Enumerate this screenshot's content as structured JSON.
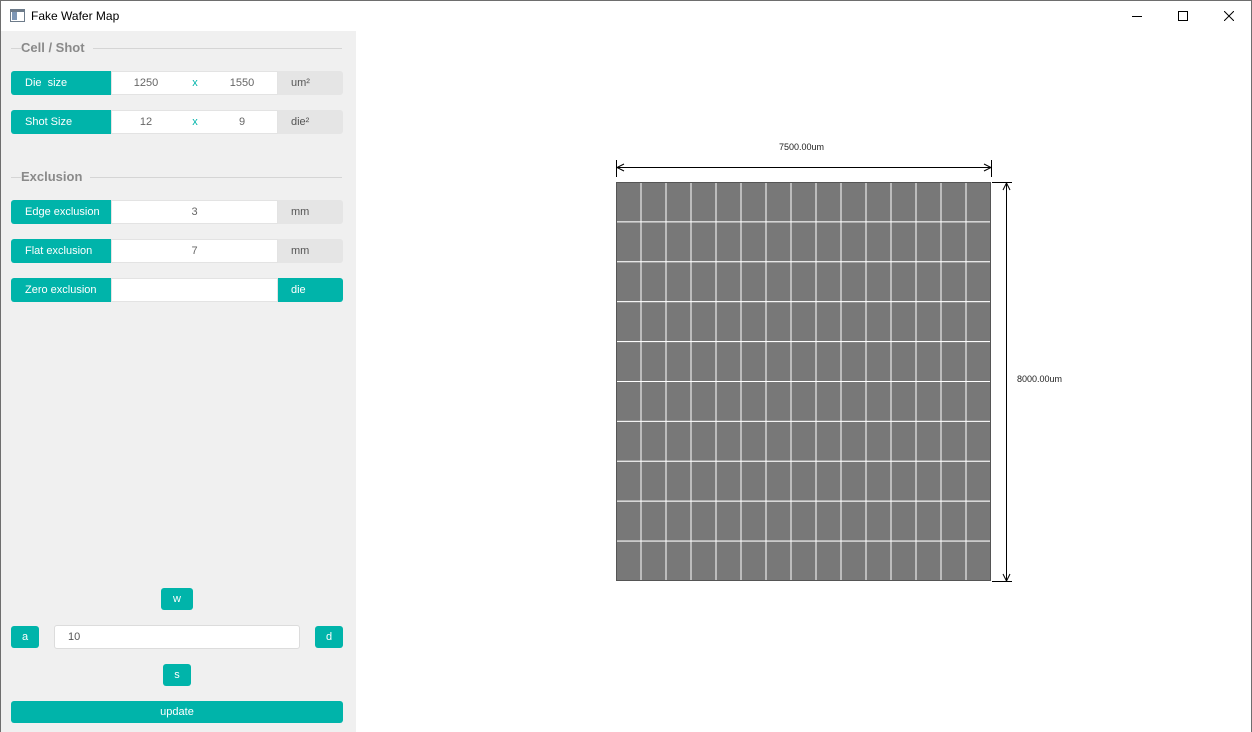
{
  "window": {
    "title": "Fake Wafer Map",
    "icon": "app-window-icon",
    "controls": [
      "minimize-icon",
      "maximize-icon",
      "close-icon"
    ]
  },
  "sidebar": {
    "cell_shot": {
      "title": "Cell / Shot",
      "die_size": {
        "label": "Die  size",
        "width": "1250",
        "x": "x",
        "height": "1550",
        "unit": "um²"
      },
      "shot_size": {
        "label": "Shot Size",
        "cols": "12",
        "x": "x",
        "rows": "9",
        "unit": "die²"
      }
    },
    "exclusion": {
      "title": "Exclusion",
      "edge": {
        "label": "Edge exclusion",
        "value": "3",
        "unit": "mm"
      },
      "flat": {
        "label": "Flat exclusion",
        "value": "7",
        "unit": "mm"
      },
      "zero": {
        "label": "Zero exclusion",
        "value": "",
        "unit": "die"
      }
    },
    "nav": {
      "up": "w",
      "left": "a",
      "right": "d",
      "down": "s",
      "step": "10"
    },
    "update_label": "update"
  },
  "wafer_map": {
    "width_label": "7500.00um",
    "height_label": "8000.00um",
    "columns": 15,
    "rows": 10,
    "die_color": "#787878",
    "grid_color": "#ffffff"
  },
  "colors": {
    "accent": "#00b4aa",
    "sidebar_bg": "#f0f0f0",
    "unit_bg": "#e5e5e5"
  }
}
